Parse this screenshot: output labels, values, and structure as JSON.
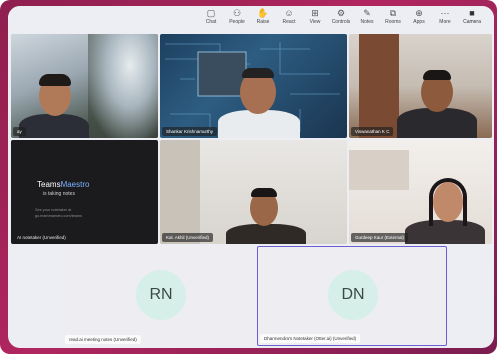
{
  "toolbar": {
    "items": [
      {
        "label": "Chat",
        "icon": "chat-icon"
      },
      {
        "label": "People",
        "icon": "people-icon"
      },
      {
        "label": "Raise",
        "icon": "raise-hand-icon"
      },
      {
        "label": "React",
        "icon": "react-icon"
      },
      {
        "label": "View",
        "icon": "view-icon"
      },
      {
        "label": "Controls",
        "icon": "controls-icon"
      },
      {
        "label": "Notes",
        "icon": "notes-icon"
      },
      {
        "label": "Rooms",
        "icon": "rooms-icon"
      },
      {
        "label": "Apps",
        "icon": "apps-icon"
      },
      {
        "label": "More",
        "icon": "more-icon"
      }
    ],
    "camera_label": "Camera"
  },
  "participants": [
    {
      "name": "ay",
      "kind": "video"
    },
    {
      "name": "Shankar Krishnamurthy",
      "kind": "video"
    },
    {
      "name": "Viswanathan K C",
      "kind": "video"
    },
    {
      "name": "AI notetaker (Unverified)",
      "kind": "app"
    },
    {
      "name": "Kal. Akhil (Unverified)",
      "kind": "video"
    },
    {
      "name": "Gurdeep Kaur (External)",
      "kind": "video"
    },
    {
      "name": "read.ai meeting notes (Unverified)",
      "kind": "avatar",
      "initials": "RN"
    },
    {
      "name": "Dharmendra's Notetaker (Otter.ai) (Unverified)",
      "kind": "avatar",
      "initials": "DN"
    }
  ],
  "teammaestro": {
    "brand_a": "Teams",
    "brand_b": "Maestro",
    "status": "is taking notes",
    "line1": "See your notetaker at",
    "line2": "go.teammaestro.com/teams"
  },
  "colors": {
    "frame": "#a8245a",
    "app_bg": "#eceef4",
    "avatar_bg": "#d7efe9",
    "active_border": "#6b5fd3"
  }
}
